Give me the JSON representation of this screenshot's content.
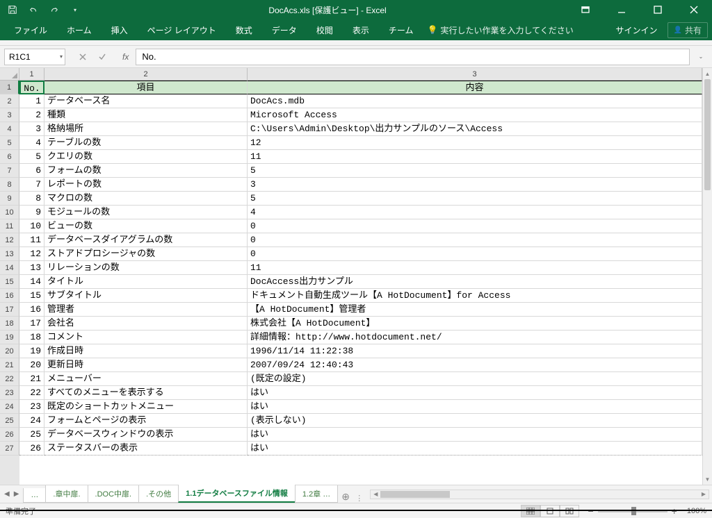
{
  "window_title": "DocAcs.xls  [保護ビュー] - Excel",
  "ribbon": {
    "file": "ファイル",
    "home": "ホーム",
    "insert": "挿入",
    "layout": "ページ レイアウト",
    "formula": "数式",
    "data": "データ",
    "review": "校閲",
    "view": "表示",
    "team": "チーム",
    "tell": "実行したい作業を入力してください",
    "signin": "サインイン",
    "share": "共有"
  },
  "namebox": "R1C1",
  "formula": "No.",
  "col_labels": {
    "c1": "1",
    "c2": "2",
    "c3": "3"
  },
  "header": {
    "no": "No.",
    "item": "項目",
    "content": "内容"
  },
  "rows": [
    {
      "n": "1",
      "item": "データベース名",
      "val": "DocAcs.mdb"
    },
    {
      "n": "2",
      "item": "種類",
      "val": "Microsoft Access"
    },
    {
      "n": "3",
      "item": "格納場所",
      "val": "C:\\Users\\Admin\\Desktop\\出力サンプルのソース\\Access"
    },
    {
      "n": "4",
      "item": "テーブルの数",
      "val": "12"
    },
    {
      "n": "5",
      "item": "クエリの数",
      "val": "11"
    },
    {
      "n": "6",
      "item": "フォームの数",
      "val": "5"
    },
    {
      "n": "7",
      "item": "レポートの数",
      "val": "3"
    },
    {
      "n": "8",
      "item": "マクロの数",
      "val": "5"
    },
    {
      "n": "9",
      "item": "モジュールの数",
      "val": "4"
    },
    {
      "n": "10",
      "item": "ビューの数",
      "val": "0"
    },
    {
      "n": "11",
      "item": "データベースダイアグラムの数",
      "val": "0"
    },
    {
      "n": "12",
      "item": "ストアドプロシージャの数",
      "val": "0"
    },
    {
      "n": "13",
      "item": "リレーションの数",
      "val": "11"
    },
    {
      "n": "14",
      "item": "タイトル",
      "val": "DocAccess出力サンプル"
    },
    {
      "n": "15",
      "item": "サブタイトル",
      "val": "ドキュメント自動生成ツール【A HotDocument】for Access"
    },
    {
      "n": "16",
      "item": "管理者",
      "val": "【A HotDocument】管理者"
    },
    {
      "n": "17",
      "item": "会社名",
      "val": "株式会社【A HotDocument】"
    },
    {
      "n": "18",
      "item": "コメント",
      "val": "詳細情報：http://www.hotdocument.net/"
    },
    {
      "n": "19",
      "item": "作成日時",
      "val": "1996/11/14 11:22:38"
    },
    {
      "n": "20",
      "item": "更新日時",
      "val": "2007/09/24 12:40:43"
    },
    {
      "n": "21",
      "item": "メニューバー",
      "val": "(既定の設定)"
    },
    {
      "n": "22",
      "item": "すべてのメニューを表示する",
      "val": "はい"
    },
    {
      "n": "23",
      "item": "既定のショートカットメニュー",
      "val": "はい"
    },
    {
      "n": "24",
      "item": "フォームとページの表示",
      "val": "(表示しない)"
    },
    {
      "n": "25",
      "item": "データベースウィンドウの表示",
      "val": "はい"
    },
    {
      "n": "26",
      "item": "ステータスバーの表示",
      "val": "はい"
    }
  ],
  "row_numbers": [
    "1",
    "2",
    "3",
    "4",
    "5",
    "6",
    "7",
    "8",
    "9",
    "10",
    "11",
    "12",
    "13",
    "14",
    "15",
    "16",
    "17",
    "18",
    "19",
    "20",
    "21",
    "22",
    "23",
    "24",
    "25",
    "26",
    "27"
  ],
  "tabs": {
    "ellipsis": "…",
    "t1": ".章中扉.",
    "t2": ".DOC中扉.",
    "t3": ".その他",
    "active": "1.1データベースファイル情報",
    "t5": "1.2章 …"
  },
  "status": "準備完了",
  "zoom": "100%"
}
